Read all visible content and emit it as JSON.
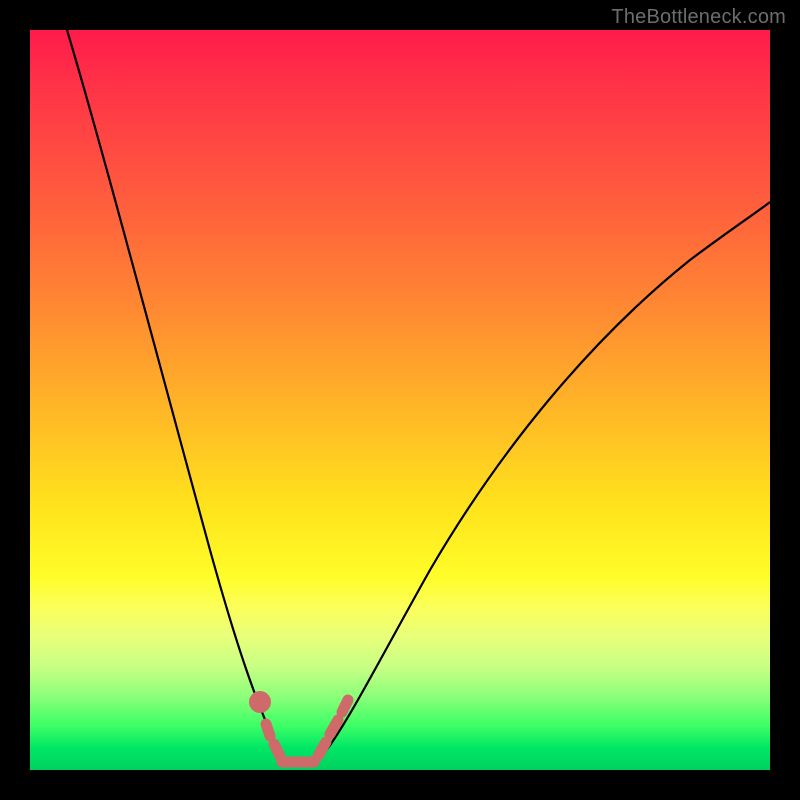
{
  "watermark": "TheBottleneck.com",
  "colors": {
    "frame": "#000000",
    "curve": "#000000",
    "marker": "#cf6a6a",
    "gradient_top": "#ff1b4b",
    "gradient_bottom": "#00d060"
  },
  "chart_data": {
    "type": "line",
    "title": "",
    "xlabel": "",
    "ylabel": "",
    "xlim": [
      0,
      100
    ],
    "ylim": [
      0,
      100
    ],
    "series": [
      {
        "name": "bottleneck-curve",
        "x": [
          5,
          8,
          12,
          16,
          20,
          24,
          27,
          29,
          31,
          33,
          34.5,
          36,
          38,
          40,
          44,
          50,
          58,
          68,
          80,
          92,
          100
        ],
        "y": [
          100,
          88,
          74,
          60,
          46,
          33,
          22,
          14,
          8,
          4,
          2,
          2,
          4,
          8,
          16,
          26,
          38,
          50,
          60,
          67,
          71
        ]
      }
    ],
    "annotations": [
      {
        "name": "valley-markers",
        "shape": "dots-and-dashes",
        "x_range": [
          29,
          39
        ],
        "y_range": [
          1,
          8
        ]
      }
    ],
    "grid": false,
    "legend": false
  }
}
